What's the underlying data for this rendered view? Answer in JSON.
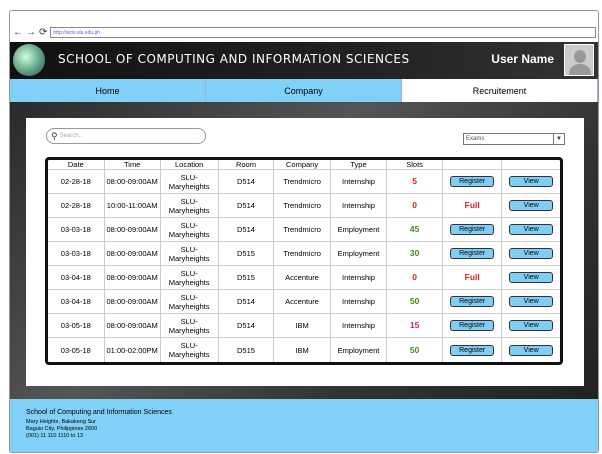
{
  "browser": {
    "url": "http://sicis.slu.edu.ph",
    "back": "←",
    "forward": "→",
    "reload": "⟳"
  },
  "header": {
    "title": "SCHOOL OF COMPUTING AND INFORMATION SCIENCES",
    "user_name": "User Name"
  },
  "nav": [
    {
      "label": "Home"
    },
    {
      "label": "Company"
    },
    {
      "label": "Recruitement"
    }
  ],
  "search": {
    "placeholder": "Search..."
  },
  "filter": {
    "selected": "Exams"
  },
  "table": {
    "headers": [
      "Date",
      "Time",
      "Location",
      "Room",
      "Company",
      "Type",
      "Slots",
      "",
      ""
    ],
    "rows": [
      {
        "date": "02-28-18",
        "time": "08:00-09:00AM",
        "location": "SLU-Maryheights",
        "room": "D514",
        "company": "Trendmicro",
        "type": "Internship",
        "slots": "5",
        "slot_color": "#e02020",
        "register": "Register",
        "view": "View"
      },
      {
        "date": "02-28-18",
        "time": "10:00-11:00AM",
        "location": "SLU-Maryheights",
        "room": "D514",
        "company": "Trendmicro",
        "type": "Internship",
        "slots": "0",
        "slot_color": "#e02020",
        "register": "Full",
        "view": "View"
      },
      {
        "date": "03-03-18",
        "time": "08:00-09:00AM",
        "location": "SLU-Maryheights",
        "room": "D514",
        "company": "Trendmicro",
        "type": "Employment",
        "slots": "45",
        "slot_color": "#4a8a1a",
        "register": "Register",
        "view": "View"
      },
      {
        "date": "03-03-18",
        "time": "08:00-09:00AM",
        "location": "SLU-Maryheights",
        "room": "D515",
        "company": "Trendmicro",
        "type": "Employment",
        "slots": "30",
        "slot_color": "#4a8a1a",
        "register": "Register",
        "view": "View"
      },
      {
        "date": "03-04-18",
        "time": "08:00-09:00AM",
        "location": "SLU-Maryheights",
        "room": "D515",
        "company": "Accenture",
        "type": "Internship",
        "slots": "0",
        "slot_color": "#e02020",
        "register": "Full",
        "view": "View"
      },
      {
        "date": "03-04-18",
        "time": "08:00-09:00AM",
        "location": "SLU-Maryheights",
        "room": "D514",
        "company": "Accenture",
        "type": "Internship",
        "slots": "50",
        "slot_color": "#4a8a1a",
        "register": "Register",
        "view": "View"
      },
      {
        "date": "03-05-18",
        "time": "08:00-09:00AM",
        "location": "SLU-Maryheights",
        "room": "D514",
        "company": "IBM",
        "type": "Internship",
        "slots": "15",
        "slot_color": "#d0206a",
        "register": "Register",
        "view": "View"
      },
      {
        "date": "03-05-18",
        "time": "01:00-02:00PM",
        "location": "SLU-Maryheights",
        "room": "D515",
        "company": "IBM",
        "type": "Employment",
        "slots": "50",
        "slot_color": "#4a8a1a",
        "register": "Register",
        "view": "View"
      }
    ]
  },
  "footer": {
    "name": "School of Computing and Information Sciences",
    "address1": "Mary Heights, Bakakeng Sur",
    "address2": "Baguio City, Philippines 2600",
    "phone": "(001) 11 110 1110 to 13"
  }
}
